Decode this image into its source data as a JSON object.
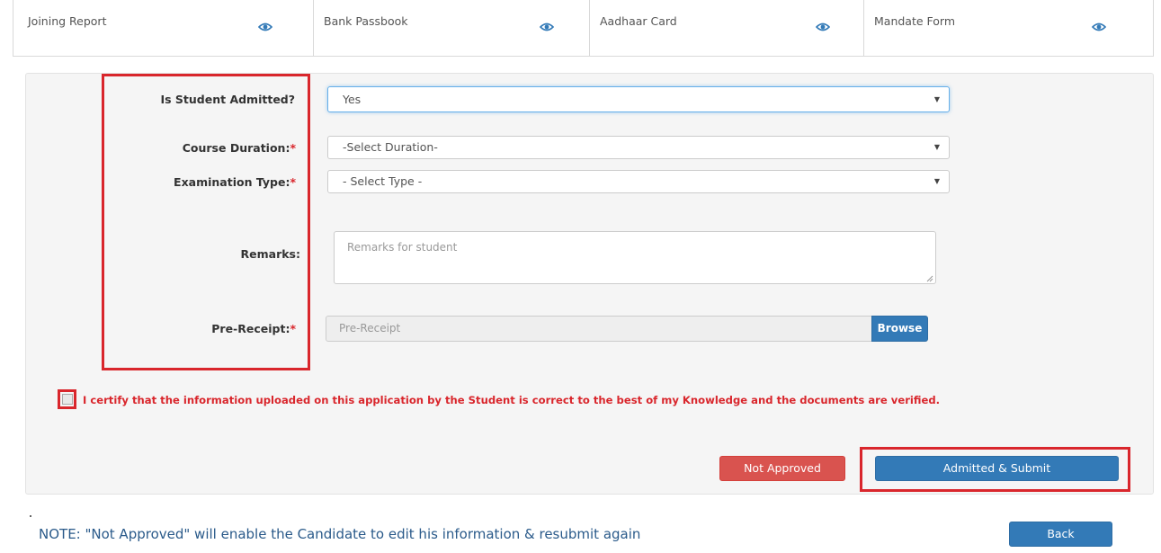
{
  "documents": [
    {
      "label": "Joining Report",
      "icon": "eye-icon"
    },
    {
      "label": "Bank Passbook",
      "icon": "eye-icon"
    },
    {
      "label": "Aadhaar Card",
      "icon": "eye-icon"
    },
    {
      "label": "Mandate Form",
      "icon": "eye-icon"
    }
  ],
  "form": {
    "admitted": {
      "label": "Is Student Admitted?",
      "value": "Yes"
    },
    "duration": {
      "label": "Course Duration:",
      "required_mark": "*",
      "value": "-Select Duration-"
    },
    "exam_type": {
      "label": "Examination Type:",
      "required_mark": "*",
      "value": "- Select Type -"
    },
    "remarks": {
      "label": "Remarks:",
      "placeholder": "Remarks for student"
    },
    "pre_receipt": {
      "label": "Pre-Receipt:",
      "required_mark": "*",
      "placeholder": "Pre-Receipt",
      "browse_label": "Browse"
    },
    "certify_text": "I certify that the information uploaded on this application by the Student is correct to the best of my Knowledge and the documents are verified.",
    "certify_checked": false
  },
  "actions": {
    "not_approved_label": "Not Approved",
    "submit_label": "Admitted & Submit",
    "back_label": "Back"
  },
  "note": "NOTE: \"Not Approved\" will enable the Candidate to edit his information & resubmit again",
  "colors": {
    "highlight": "#d9262c",
    "primary": "#337ab7",
    "danger": "#d9534f"
  }
}
